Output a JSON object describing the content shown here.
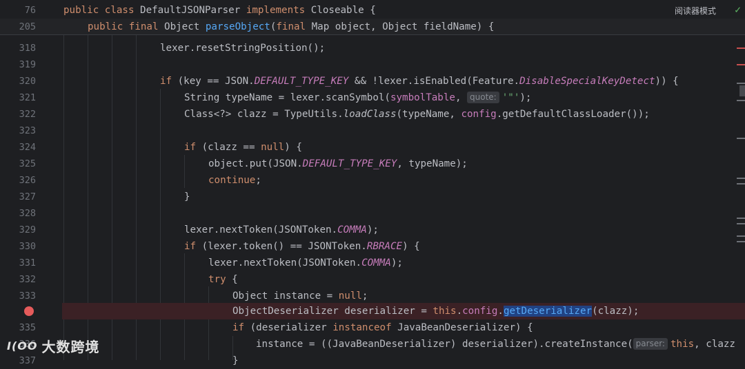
{
  "sticky": [
    {
      "num": "76",
      "text_parts": [
        "public",
        " ",
        "class",
        " DefaultJSONParser ",
        "implements",
        " Closeable {"
      ]
    },
    {
      "num": "205",
      "text_parts": [
        "public",
        " ",
        "final",
        " Object ",
        "parseObject",
        "(",
        "final",
        " Map object, Object fieldName) {"
      ]
    }
  ],
  "toolbar": {
    "reader_mode": "阅读器模式"
  },
  "lines": [
    {
      "num": "318"
    },
    {
      "num": "319"
    },
    {
      "num": "320"
    },
    {
      "num": "321"
    },
    {
      "num": "322"
    },
    {
      "num": "323"
    },
    {
      "num": "324"
    },
    {
      "num": "325"
    },
    {
      "num": "326"
    },
    {
      "num": "327"
    },
    {
      "num": "328"
    },
    {
      "num": "329"
    },
    {
      "num": "330"
    },
    {
      "num": "331"
    },
    {
      "num": "332"
    },
    {
      "num": "333"
    },
    {
      "num": ""
    },
    {
      "num": "335"
    },
    {
      "num": "336"
    },
    {
      "num": "337"
    }
  ],
  "code": {
    "l318": "lexer.resetStringPosition();",
    "l320_a": "if",
    "l320_b": " (key == JSON.",
    "l320_c": "DEFAULT_TYPE_KEY",
    "l320_d": " && !lexer.isEnabled(Feature.",
    "l320_e": "DisableSpecialKeyDetect",
    "l320_f": ")) {",
    "l321_a": "String typeName = lexer.scanSymbol(",
    "l321_b": "symbolTable",
    "l321_c": ", ",
    "l321_hint": "quote:",
    "l321_d": "'\"'",
    "l321_e": ");",
    "l322_a": "Class<?> clazz = TypeUtils.",
    "l322_b": "loadClass",
    "l322_c": "(typeName, ",
    "l322_d": "config",
    "l322_e": ".getDefaultClassLoader());",
    "l324_a": "if",
    "l324_b": " (clazz == ",
    "l324_c": "null",
    "l324_d": ") {",
    "l325_a": "object.put(JSON.",
    "l325_b": "DEFAULT_TYPE_KEY",
    "l325_c": ", typeName);",
    "l326_a": "continue",
    "l326_b": ";",
    "l327": "}",
    "l329_a": "lexer.nextToken(JSONToken.",
    "l329_b": "COMMA",
    "l329_c": ");",
    "l330_a": "if",
    "l330_b": " (lexer.token() == JSONToken.",
    "l330_c": "RBRACE",
    "l330_d": ") {",
    "l331_a": "lexer.nextToken(JSONToken.",
    "l331_b": "COMMA",
    "l331_c": ");",
    "l332_a": "try",
    "l332_b": " {",
    "l333_a": "Object instance = ",
    "l333_b": "null",
    "l333_c": ";",
    "l334_a": "ObjectDeserializer deserializer = ",
    "l334_b": "this",
    "l334_c": ".",
    "l334_d": "config",
    "l334_e": ".",
    "l334_f": "getDeserializer",
    "l334_g": "(clazz);",
    "l335_a": "if",
    "l335_b": " (deserializer ",
    "l335_c": "instanceof",
    "l335_d": " JavaBeanDeserializer) {",
    "l336_a": "instance = ((JavaBeanDeserializer) deserializer).createInstance(",
    "l336_hint": "parser:",
    "l336_b": "this",
    "l336_c": ", clazz",
    "l337": "}"
  },
  "watermark": {
    "logo": "I(OO",
    "text": "大数跨境"
  },
  "colors": {
    "background": "#1e1f22",
    "keyword": "#cf8e6d",
    "function": "#56a8f5",
    "field": "#c77dbb",
    "string": "#6aab73",
    "breakpoint": "#e55b5b",
    "selection": "#214283"
  }
}
